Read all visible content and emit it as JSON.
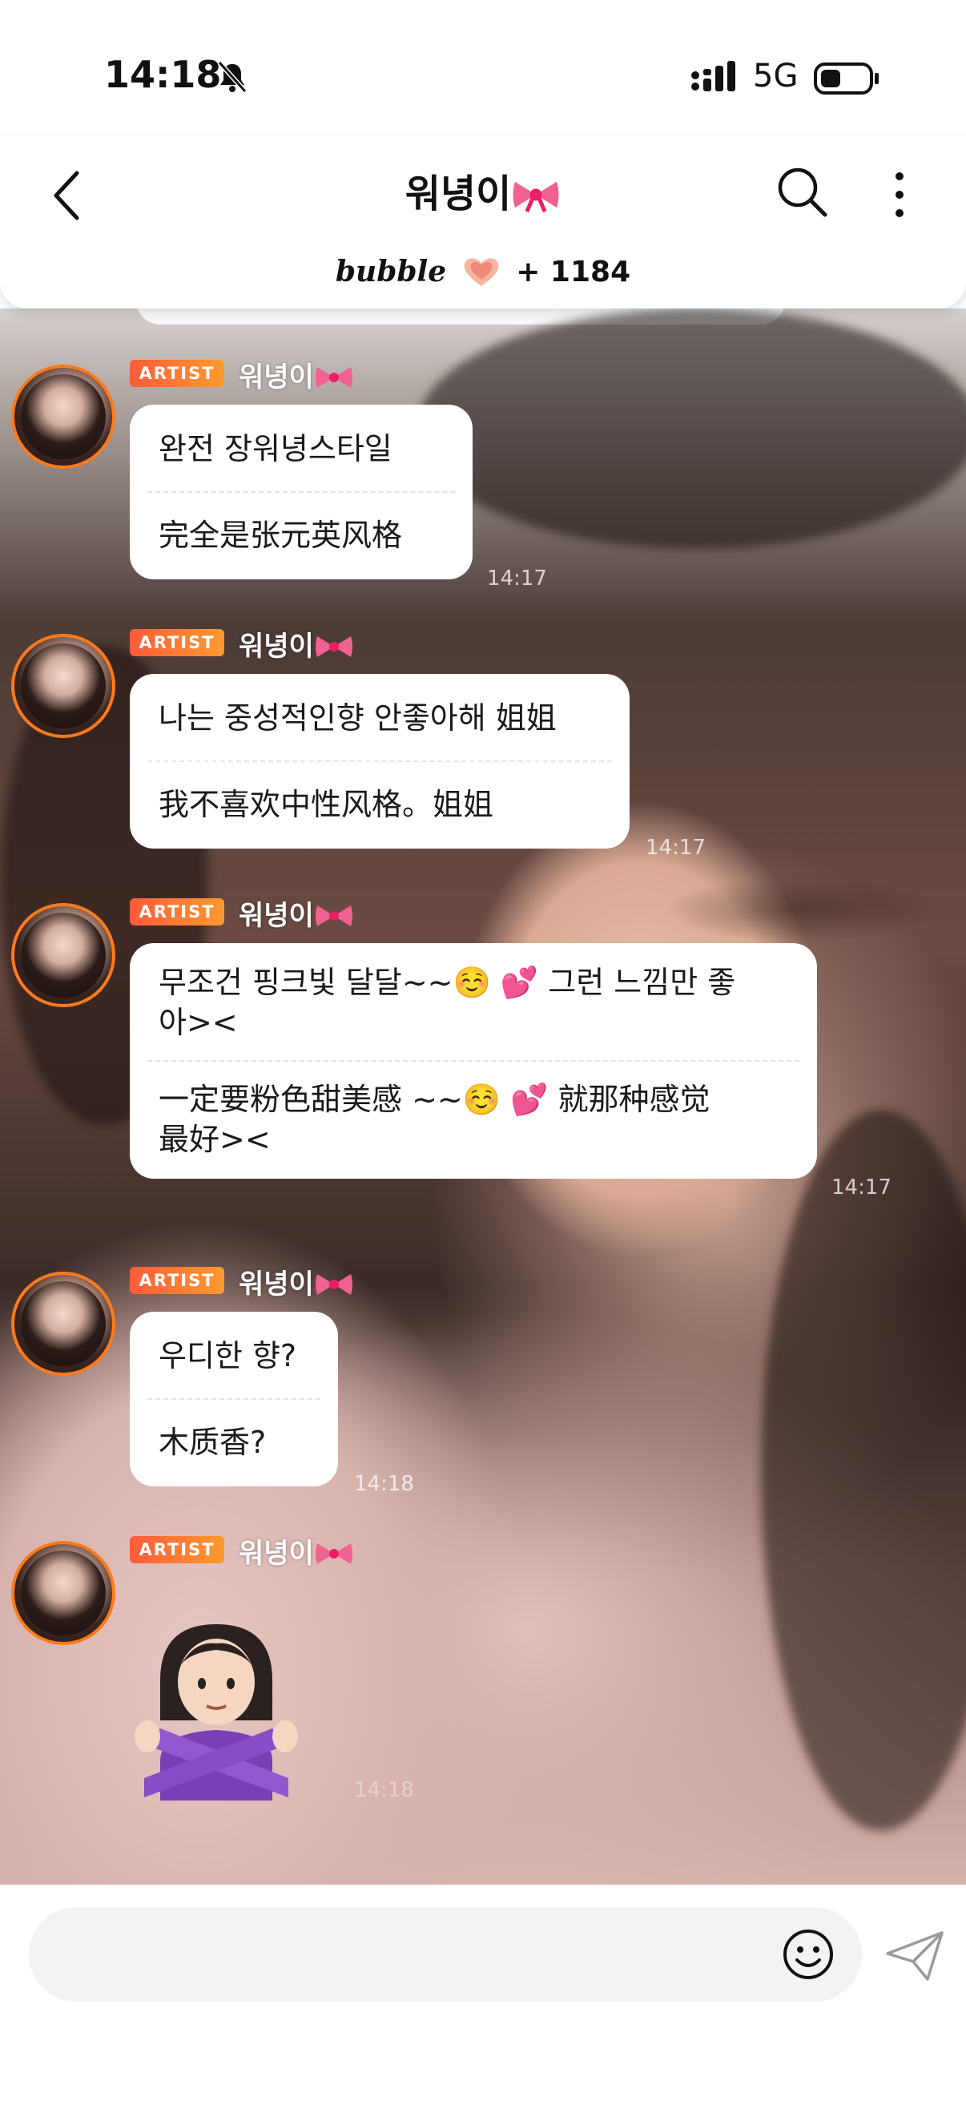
{
  "status_bar": {
    "time": "14:18",
    "network": "5G"
  },
  "header": {
    "title": "워녕이",
    "bubble_brand": "bubble",
    "bubble_count": "+ 1184"
  },
  "messages": [
    {
      "badge": "ARTIST",
      "sender": "워녕이",
      "lines": [
        "완전 장워녕스타일",
        "完全是张元英风格"
      ],
      "time": "14:17"
    },
    {
      "badge": "ARTIST",
      "sender": "워녕이",
      "lines": [
        "나는 중성적인향 안좋아해 姐姐",
        "我不喜欢中性风格。姐姐"
      ],
      "time": "14:17"
    },
    {
      "badge": "ARTIST",
      "sender": "워녕이",
      "lines": [
        "무조건 핑크빛 달달~~☺️ 💕 그런 느낌만 좋",
        "아><",
        "一定要粉色甜美感 ~~☺️ 💕 就那种感觉",
        "最好><"
      ],
      "time": "14:17"
    },
    {
      "badge": "ARTIST",
      "sender": "워녕이",
      "lines": [
        "우디한 향?",
        "木质香?"
      ],
      "time": "14:18"
    },
    {
      "badge": "ARTIST",
      "sender": "워녕이",
      "emoji": "🙅🏻‍♀️",
      "time": "14:18"
    }
  ],
  "input": {
    "placeholder": ""
  },
  "colors": {
    "accent": "#ff7a1a",
    "badge_start": "#ff5b3a",
    "badge_end": "#ff9a2e"
  }
}
